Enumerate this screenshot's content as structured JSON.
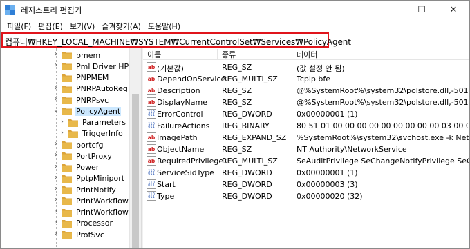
{
  "window": {
    "title": "레지스트리 편집기",
    "controls": {
      "minimize": "—",
      "maximize": "☐",
      "close": "✕"
    }
  },
  "menu": {
    "items": [
      "파일(F)",
      "편집(E)",
      "보기(V)",
      "즐겨찾기(A)",
      "도움말(H)"
    ]
  },
  "address": {
    "path": "컴퓨터₩HKEY_LOCAL_MACHINE₩SYSTEM₩CurrentControlSet₩Services₩PolicyAgent"
  },
  "tree": {
    "items": [
      {
        "label": "pmem",
        "expandable": true
      },
      {
        "label": "Pml Driver HPZ",
        "expandable": true
      },
      {
        "label": "PNPMEM",
        "expandable": false
      },
      {
        "label": "PNRPAutoReg",
        "expandable": true
      },
      {
        "label": "PNRPsvc",
        "expandable": true
      },
      {
        "label": "PolicyAgent",
        "expandable": true,
        "expanded": true,
        "selected": true
      },
      {
        "label": "Parameters",
        "expandable": true,
        "child": true
      },
      {
        "label": "TriggerInfo",
        "expandable": true,
        "child": true
      },
      {
        "label": "portcfg",
        "expandable": true
      },
      {
        "label": "PortProxy",
        "expandable": true
      },
      {
        "label": "Power",
        "expandable": true
      },
      {
        "label": "PptpMiniport",
        "expandable": true
      },
      {
        "label": "PrintNotify",
        "expandable": true
      },
      {
        "label": "PrintWorkflowU",
        "expandable": true
      },
      {
        "label": "PrintWorkflowU",
        "expandable": true
      },
      {
        "label": "Processor",
        "expandable": true
      },
      {
        "label": "ProfSvc",
        "expandable": true
      }
    ],
    "expander_collapsed": "›",
    "expander_expanded": "⌄"
  },
  "list": {
    "columns": {
      "name": "이름",
      "type": "종류",
      "data": "데이터"
    },
    "values": [
      {
        "name": "(기본값)",
        "type": "REG_SZ",
        "data": "(값 설정 안 됨)",
        "icon": "string-value-icon"
      },
      {
        "name": "DependOnService",
        "type": "REG_MULTI_SZ",
        "data": "Tcpip bfe",
        "icon": "string-value-icon"
      },
      {
        "name": "Description",
        "type": "REG_SZ",
        "data": "@%SystemRoot%\\system32\\polstore.dll,-5011",
        "icon": "string-value-icon"
      },
      {
        "name": "DisplayName",
        "type": "REG_SZ",
        "data": "@%SystemRoot%\\system32\\polstore.dll,-5010",
        "icon": "string-value-icon"
      },
      {
        "name": "ErrorControl",
        "type": "REG_DWORD",
        "data": "0x00000001 (1)",
        "icon": "binary-value-icon"
      },
      {
        "name": "FailureActions",
        "type": "REG_BINARY",
        "data": "80 51 01 00 00 00 00 00 00 00 00 00 03 00 00...",
        "icon": "binary-value-icon"
      },
      {
        "name": "ImagePath",
        "type": "REG_EXPAND_SZ",
        "data": "%SystemRoot%\\system32\\svchost.exe -k Netw...",
        "icon": "string-value-icon"
      },
      {
        "name": "ObjectName",
        "type": "REG_SZ",
        "data": "NT Authority\\NetworkService",
        "icon": "string-value-icon"
      },
      {
        "name": "RequiredPrivilege...",
        "type": "REG_MULTI_SZ",
        "data": "SeAuditPrivilege SeChangeNotifyPrivilege SeCrea...",
        "icon": "string-value-icon"
      },
      {
        "name": "ServiceSidType",
        "type": "REG_DWORD",
        "data": "0x00000001 (1)",
        "icon": "binary-value-icon"
      },
      {
        "name": "Start",
        "type": "REG_DWORD",
        "data": "0x00000003 (3)",
        "icon": "binary-value-icon"
      },
      {
        "name": "Type",
        "type": "REG_DWORD",
        "data": "0x00000020 (32)",
        "icon": "binary-value-icon"
      }
    ]
  },
  "colors": {
    "highlight_border": "#e0141b",
    "selection": "#cce8ff",
    "folder": "#e8b84a"
  }
}
